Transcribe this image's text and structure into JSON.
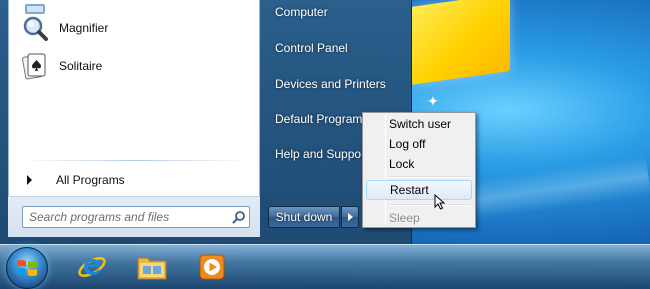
{
  "desktop": {
    "background_color": "#1a6fb5"
  },
  "start_menu": {
    "programs": [
      {
        "label": "Magnifier",
        "icon": "magnifier-icon"
      },
      {
        "label": "Solitaire",
        "icon": "solitaire-icon"
      }
    ],
    "all_programs_label": "All Programs",
    "search": {
      "placeholder": "Search programs and files"
    },
    "right_items": [
      {
        "label": "Computer"
      },
      {
        "label": "Control Panel"
      },
      {
        "label": "Devices and Printers"
      },
      {
        "label": "Default Programs"
      },
      {
        "label": "Help and Support"
      }
    ],
    "shutdown_label": "Shut down"
  },
  "context_menu": {
    "items": [
      {
        "label": "Switch user",
        "state": "normal"
      },
      {
        "label": "Log off",
        "state": "normal"
      },
      {
        "label": "Lock",
        "state": "normal"
      },
      {
        "label": "Restart",
        "state": "hover"
      },
      {
        "label": "Sleep",
        "state": "disabled"
      }
    ]
  },
  "taskbar": {
    "items": [
      {
        "icon": "internet-explorer-icon"
      },
      {
        "icon": "windows-explorer-icon"
      },
      {
        "icon": "media-player-icon"
      }
    ]
  },
  "colors": {
    "start_menu_bg": "#2b5f8c",
    "hover_border": "#a8d8f9",
    "wallpaper_logo": "#ffd200"
  }
}
